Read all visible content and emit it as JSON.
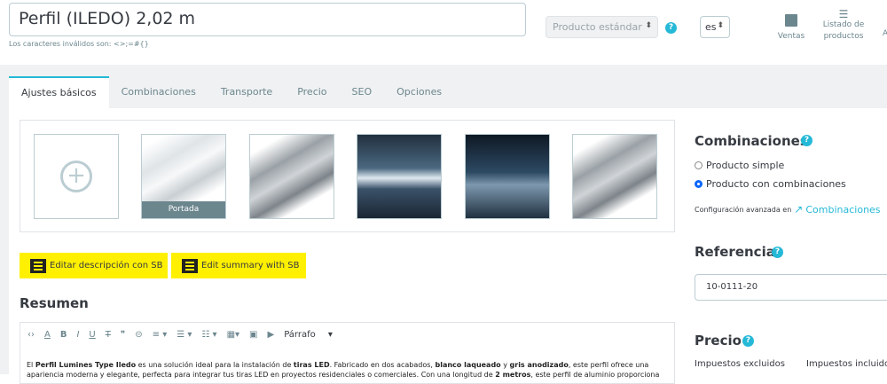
{
  "header": {
    "product_name": "Perfil (ILEDO) 2,02 m",
    "invalid_chars_hint": "Los caracteres inválidos son: <>;=#{}",
    "product_type": "Producto estándar",
    "language": "es",
    "help": "?",
    "nav": [
      {
        "label": "Ventas",
        "icon": "bar-chart-icon"
      },
      {
        "label": "Listado de productos",
        "icon": "list-icon"
      },
      {
        "label": "A"
      }
    ]
  },
  "tabs": [
    "Ajustes básicos",
    "Combinaciones",
    "Transporte",
    "Precio",
    "SEO",
    "Opciones"
  ],
  "images": {
    "cover_label": "Portada",
    "add_icon": "plus-icon"
  },
  "buttons": {
    "edit_description": "Editar descripción con SB",
    "edit_summary": "Edit summary with SB"
  },
  "summary": {
    "title": "Resumen",
    "format": "Párrafo",
    "text_line1": [
      {
        "t": "El "
      },
      {
        "t": "Perfil Lumines Type Iledo",
        "b": true
      },
      {
        "t": " es una solución ideal para la instalación de "
      },
      {
        "t": "tiras LED",
        "b": true
      },
      {
        "t": ". Fabricado en dos acabados, "
      },
      {
        "t": "blanco laqueado",
        "b": true
      },
      {
        "t": " y "
      },
      {
        "t": "gris anodizado",
        "b": true
      },
      {
        "t": ", este perfil ofrece una"
      }
    ],
    "text_line2": [
      {
        "t": "apariencia moderna y elegante, perfecta para integrar tus tiras LED en proyectos residenciales o comerciales. Con una longitud de "
      },
      {
        "t": "2 metros",
        "b": true
      },
      {
        "t": ", este perfil de aluminio proporciona"
      }
    ]
  },
  "combinations": {
    "title": "Combinaciones",
    "option_simple": "Producto simple",
    "option_combinations": "Producto con combinaciones",
    "selected": "Producto con combinaciones",
    "advanced_prefix": "Configuración avanzada en",
    "advanced_link": "Combinaciones"
  },
  "reference": {
    "title": "Referencia",
    "value": "10-0111-20"
  },
  "price": {
    "title": "Precio",
    "tax_excluded": "Impuestos excluidos",
    "tax_included": "Impuestos incluidos"
  },
  "colors": {
    "accent": "#25b9d7",
    "sb_yellow": "#fff000"
  }
}
